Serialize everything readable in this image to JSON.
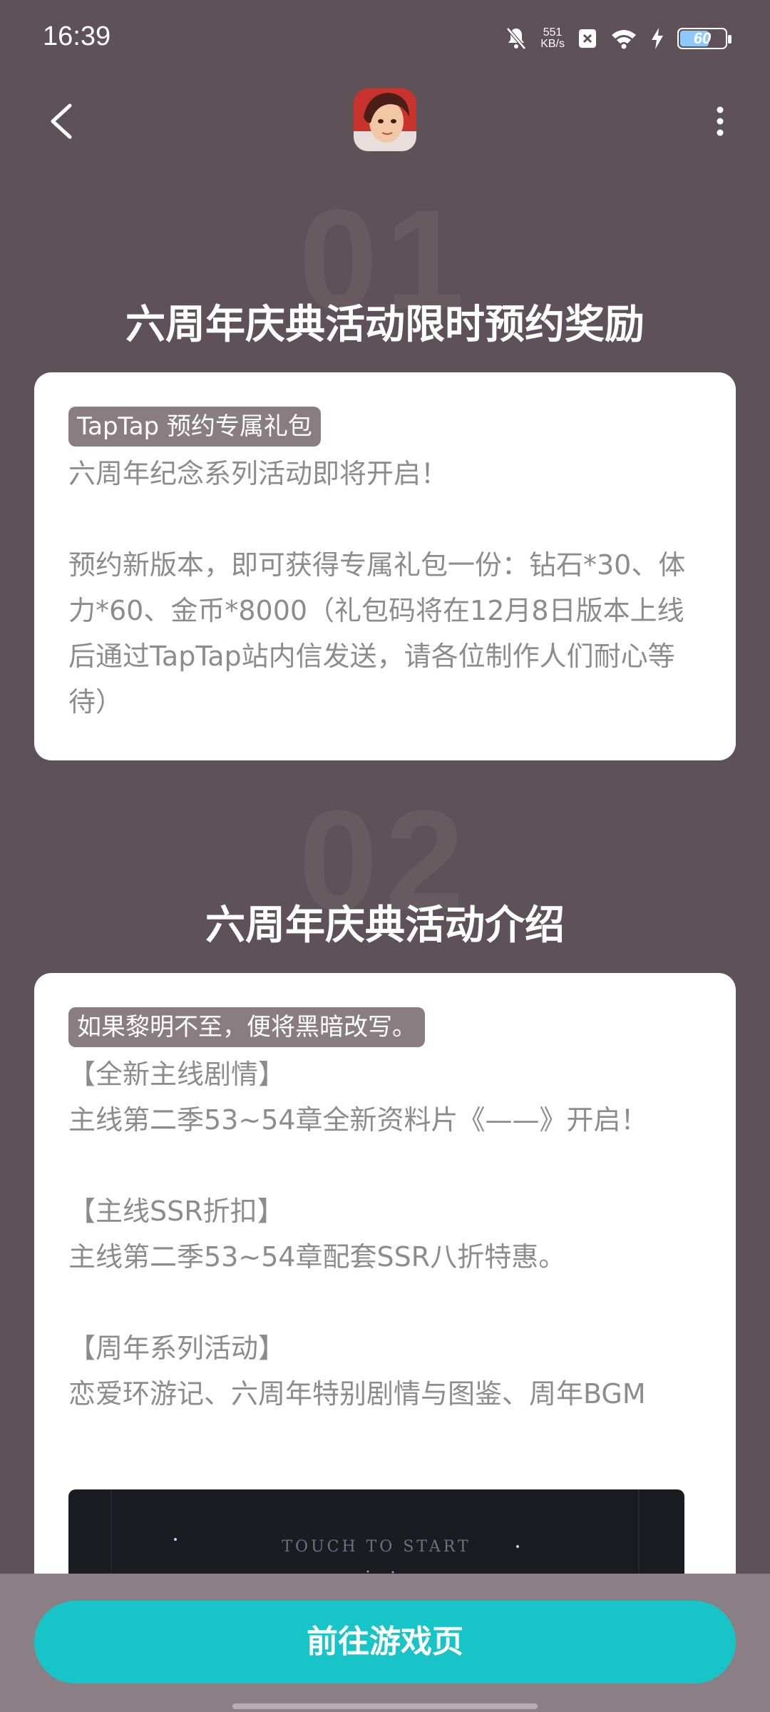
{
  "status": {
    "time": "16:39",
    "net_speed_value": "551",
    "net_speed_unit": "KB/s",
    "battery": "60"
  },
  "sections": [
    {
      "number": "01",
      "title": "六周年庆典活动限时预约奖励",
      "tag": "TapTap 预约专属礼包",
      "text": "六周年纪念系列活动即将开启！\n\n预约新版本，即可获得专属礼包一份：钻石*30、体力*60、金币*8000（礼包码将在12月8日版本上线后通过TapTap站内信发送，请各位制作人们耐心等待）"
    },
    {
      "number": "02",
      "title": "六周年庆典活动介绍",
      "tag": "如果黎明不至，便将黑暗改写。",
      "text": "【全新主线剧情】\n主线第二季53~54章全新资料片《——》开启！\n\n【主线SSR折扣】\n主线第二季53~54章配套SSR八折特惠。\n\n【周年系列活动】\n恋爱环游记、六周年特别剧情与图鉴、周年BGM"
    }
  ],
  "video": {
    "caption": "TOUCH TO START"
  },
  "cta": {
    "label": "前往游戏页"
  },
  "colors": {
    "background": "#5e5157",
    "accent": "#17c4c7",
    "tag_bg": "#8a7d82"
  },
  "icons": [
    "back-arrow-icon",
    "more-vertical-icon",
    "bell-muted-icon",
    "wifi-icon",
    "charging-icon",
    "battery-icon"
  ]
}
